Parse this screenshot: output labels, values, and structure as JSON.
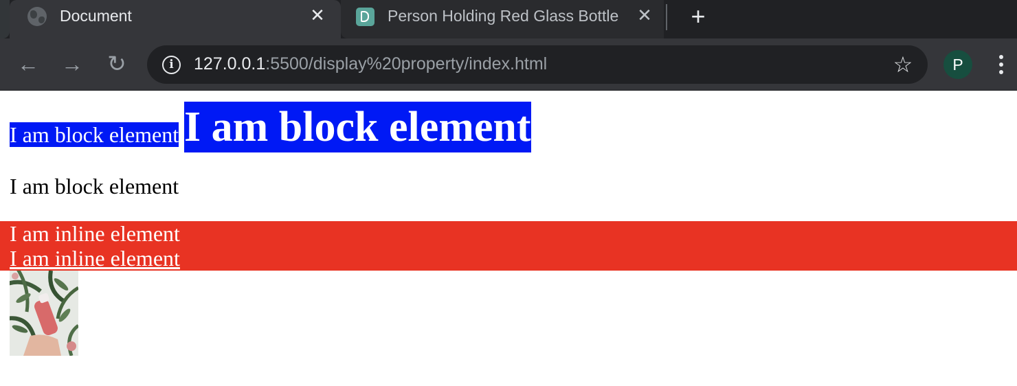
{
  "browser": {
    "tabs": [
      {
        "title": "Document",
        "active": true,
        "favicon": "globe-icon"
      },
      {
        "title": "Person Holding Red Glass Bottle",
        "active": false,
        "favicon": "pexels-icon"
      }
    ],
    "close_glyph": "✕",
    "new_tab_glyph": "+",
    "nav": {
      "back_glyph": "←",
      "forward_glyph": "→",
      "reload_glyph": "↻"
    },
    "address": {
      "host": "127.0.0.1",
      "path": ":5500/display%20property/index.html"
    },
    "bookmark_glyph": "☆",
    "profile_initial": "P",
    "colors": {
      "frame": "#202124",
      "toolbar": "#35363a",
      "profile": "#174e3f"
    }
  },
  "page": {
    "inline_small": "I am block element",
    "inline_big": "I am block element",
    "block_plain": "I am block element",
    "red_line": "I am inline element",
    "red_link": "I am inline element",
    "image_alt": "Person holding red glass bottle",
    "colors": {
      "blue": "#0019f5",
      "red": "#e83323",
      "text": "#000000"
    }
  }
}
